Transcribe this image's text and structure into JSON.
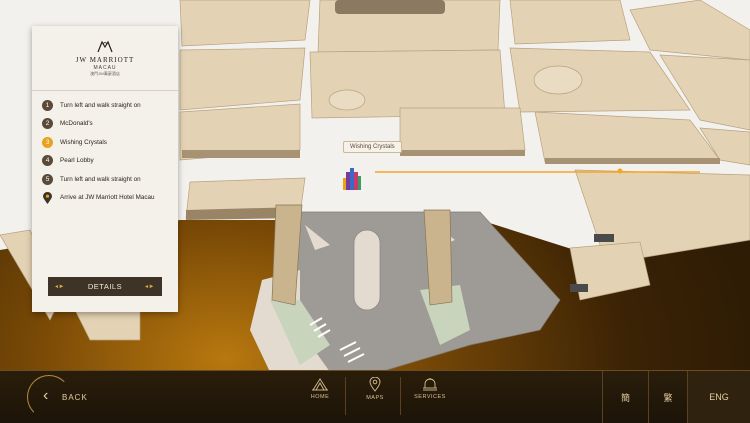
{
  "colors": {
    "accent": "#e8a21c",
    "panel_bg": "#f4f0ea",
    "button_bg": "#3d3326",
    "route": "#f5a623"
  },
  "panel": {
    "logo_title": "JW MARRIOTT",
    "logo_sub": "MACAU",
    "logo_chinese": "澳門JW萬豪酒店",
    "steps": [
      {
        "num": "1",
        "label": "Turn left and walk straight on"
      },
      {
        "num": "2",
        "label": "McDonald's"
      },
      {
        "num": "3",
        "label": "Wishing Crystals"
      },
      {
        "num": "4",
        "label": "Pearl Lobby"
      },
      {
        "num": "5",
        "label": "Turn left and walk straight on"
      },
      {
        "num": "",
        "label": "Arrive at JW Marriott Hotel Macau"
      }
    ],
    "active_step": 3,
    "details_label": "DETAILS"
  },
  "map": {
    "pin_label": "Wishing Crystals"
  },
  "bottom_bar": {
    "back_label": "BACK",
    "nav": [
      {
        "label": "HOME",
        "icon": "home-icon"
      },
      {
        "label": "MAPS",
        "icon": "location-pin-icon"
      },
      {
        "label": "SERVICES",
        "icon": "bell-icon"
      }
    ],
    "languages": [
      {
        "label": "簡",
        "active": false
      },
      {
        "label": "繁",
        "active": false
      },
      {
        "label": "ENG",
        "active": true
      }
    ]
  }
}
